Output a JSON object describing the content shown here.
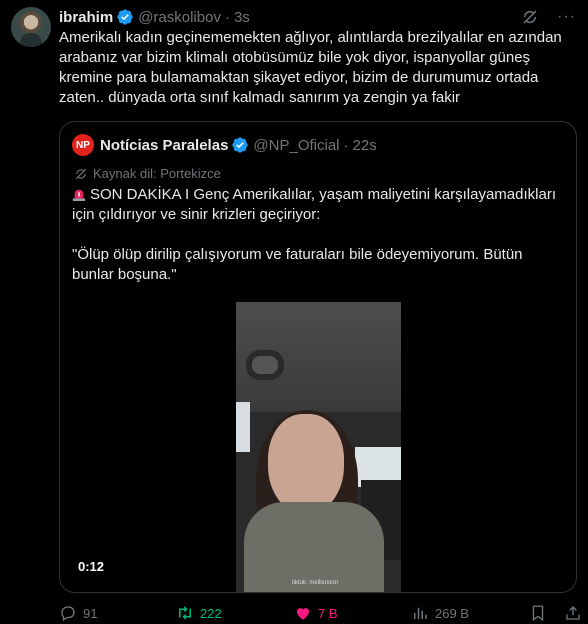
{
  "tweet": {
    "name": "ibrahim",
    "handle": "@raskolibov",
    "time": "3s",
    "text": "Amerikalı kadın geçinememekten ağlıyor, alıntılarda brezilyalılar en azından arabanız var bizim klimalı otobüsümüz bile yok diyor, ispanyollar güneş kremine para bulamamaktan şikayet ediyor, bizim de durumumuz ortada zaten.. dünyada orta sınıf kalmadı sanırım ya zengin ya fakir"
  },
  "quote": {
    "logo_text": "NP",
    "name": "Notícias Paralelas",
    "handle": "@NP_Oficial",
    "time": "22s",
    "translate_label": "Kaynak dil: Portekizce",
    "paragraph1": "SON DAKİKA I Genç Amerikalılar, yaşam maliyetini karşılayamadıkları için çıldırıyor ve sinir krizleri geçiriyor:",
    "paragraph2": "\"Ölüp ölüp dirilip çalışıyorum ve faturaları bile ödeyemiyorum. Bütün bunlar boşuna.\"",
    "video": {
      "duration": "0:12",
      "watermark": "tiktok: mellisnoon"
    }
  },
  "actions": {
    "replies": "91",
    "retweets": "222",
    "likes": "7 B",
    "views": "269 B"
  },
  "colors": {
    "background": "#000000",
    "text": "#e7e9ea",
    "muted": "#71767b",
    "verified": "#1d9bf0",
    "retweet_active": "#00ba7c",
    "like_active": "#f91880",
    "np_brand": "#e4221c"
  }
}
